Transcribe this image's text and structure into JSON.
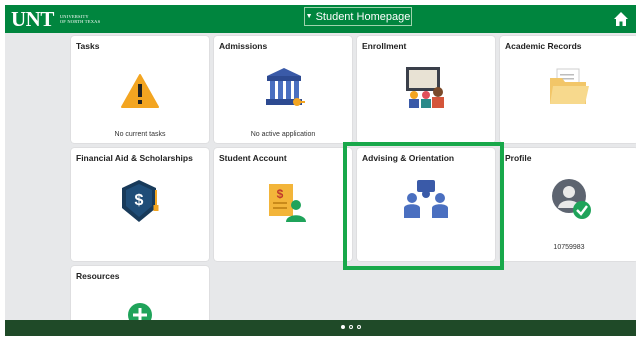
{
  "header": {
    "logo_text": "UNT",
    "logo_sub_line1": "UNIVERSITY",
    "logo_sub_line2": "OF NORTH TEXAS",
    "page_title": "Student Homepage",
    "home_icon": "home-icon"
  },
  "tiles": {
    "tasks": {
      "title": "Tasks",
      "subtitle": "No current tasks",
      "icon": "warning-icon"
    },
    "admissions": {
      "title": "Admissions",
      "subtitle": "No active application",
      "icon": "university-building-icon"
    },
    "enrollment": {
      "title": "Enrollment",
      "icon": "classroom-icon"
    },
    "academic_records": {
      "title": "Academic Records",
      "icon": "folder-icon"
    },
    "financial_aid": {
      "title": "Financial Aid & Scholarships",
      "icon": "graduation-cap-dollar-icon"
    },
    "student_account": {
      "title": "Student Account",
      "icon": "account-statement-icon"
    },
    "advising": {
      "title": "Advising & Orientation",
      "icon": "advising-people-icon"
    },
    "profile": {
      "title": "Profile",
      "subtitle": "10759983",
      "icon": "profile-avatar-icon"
    },
    "resources": {
      "title": "Resources",
      "icon": "add-circle-icon"
    }
  },
  "pagination": {
    "pages": 3,
    "current": 1
  },
  "colors": {
    "brand_green": "#00853e",
    "footer_green": "#1f4a28",
    "highlight_green": "#18a84a"
  }
}
